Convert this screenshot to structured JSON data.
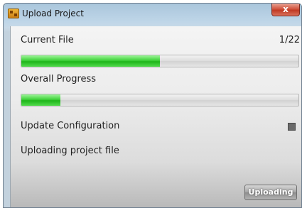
{
  "window": {
    "title": "Upload Project",
    "close_label": "x"
  },
  "current_file": {
    "label": "Current File",
    "counter": "1/22",
    "progress": 0.5
  },
  "overall": {
    "label": "Overall Progress",
    "progress": 0.14
  },
  "update_configuration": {
    "label": "Update Configuration",
    "checked": true
  },
  "status_text": "Uploading project file",
  "action_button_label": "Uploading",
  "colors": {
    "progress_fill": "#2fc42a",
    "title_bar": "#b8d1e5",
    "close_button": "#c8442c"
  }
}
